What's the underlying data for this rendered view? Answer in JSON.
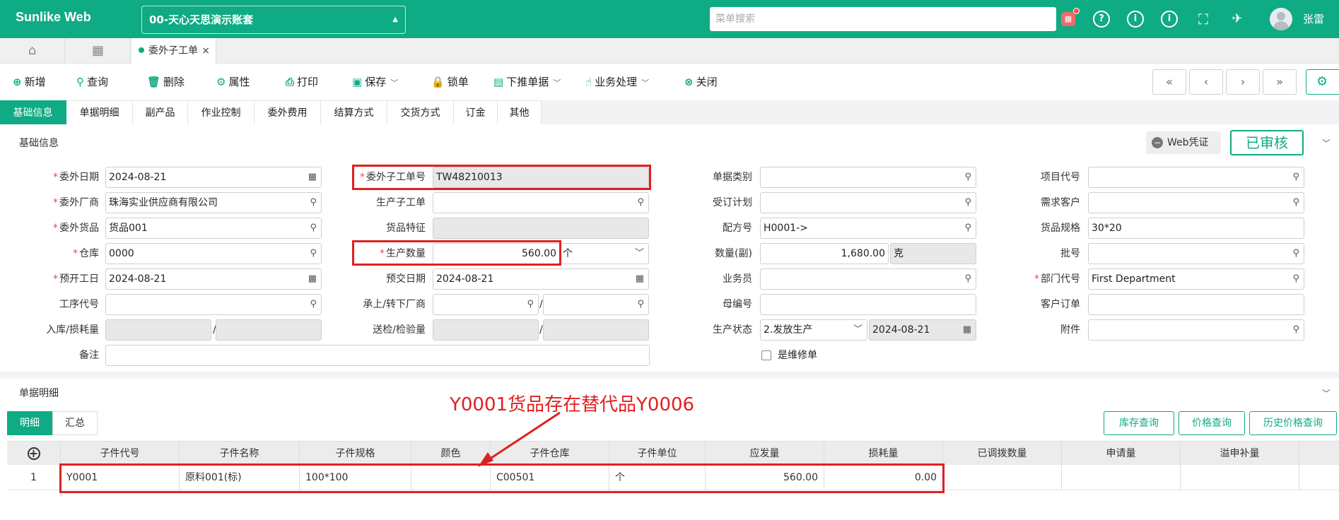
{
  "brand": "Sunlike Web",
  "account": "00-天心天思演示账套",
  "menu_search_placeholder": "菜单搜索",
  "username": "张雷",
  "tabs": {
    "doc_tab": "委外子工单"
  },
  "toolbar": {
    "add": "新增",
    "query": "查询",
    "delete": "删除",
    "props": "属性",
    "print": "打印",
    "save": "保存",
    "lock": "锁单",
    "push": "下推单据",
    "business": "业务处理",
    "close": "关闭"
  },
  "subtabs": [
    "基础信息",
    "单据明细",
    "副产品",
    "作业控制",
    "委外费用",
    "结算方式",
    "交货方式",
    "订金",
    "其他"
  ],
  "basic": {
    "title": "基础信息",
    "web_cert": "Web凭证",
    "status": "已审核",
    "fields": {
      "outsource_date": {
        "label": "委外日期",
        "value": "2024-08-21"
      },
      "vendor": {
        "label": "委外厂商",
        "value": "珠海实业供应商有限公司"
      },
      "outsource_goods": {
        "label": "委外货品",
        "value": "货品001"
      },
      "warehouse": {
        "label": "仓库",
        "value": "0000"
      },
      "plan_start": {
        "label": "预开工日",
        "value": "2024-08-21"
      },
      "process_code": {
        "label": "工序代号",
        "value": ""
      },
      "in_loss_qty": {
        "label": "入库/损耗量",
        "value": ""
      },
      "remark": {
        "label": "备注",
        "value": ""
      },
      "order_no": {
        "label": "委外子工单号",
        "value": "TW48210013"
      },
      "prod_sub_order": {
        "label": "生产子工单",
        "value": ""
      },
      "goods_feature": {
        "label": "货品特征",
        "value": ""
      },
      "prod_qty": {
        "label": "生产数量",
        "value": "560.00",
        "unit": "个"
      },
      "plan_delivery": {
        "label": "预交日期",
        "value": "2024-08-21"
      },
      "up_down_vendor": {
        "label": "承上/转下厂商",
        "value": ""
      },
      "inspect_qty": {
        "label": "送检/检验量",
        "value": ""
      },
      "doc_category": {
        "label": "单据类别",
        "value": ""
      },
      "order_plan": {
        "label": "受订计划",
        "value": ""
      },
      "formula_no": {
        "label": "配方号",
        "value": "H0001->"
      },
      "qty_sub": {
        "label": "数量(副)",
        "value": "1,680.00",
        "unit": "克"
      },
      "salesperson": {
        "label": "业务员",
        "value": ""
      },
      "parent_no": {
        "label": "母编号",
        "value": ""
      },
      "prod_status": {
        "label": "生产状态",
        "value": "2.发放生产",
        "date": "2024-08-21"
      },
      "is_repair": {
        "label": "是维修单"
      },
      "project_code": {
        "label": "项目代号",
        "value": ""
      },
      "demand_customer": {
        "label": "需求客户",
        "value": ""
      },
      "goods_spec": {
        "label": "货品规格",
        "value": "30*20"
      },
      "batch_no": {
        "label": "批号",
        "value": ""
      },
      "dept_code": {
        "label": "部门代号",
        "value": "First Department"
      },
      "customer_order": {
        "label": "客户订单",
        "value": ""
      },
      "attachment": {
        "label": "附件",
        "value": ""
      }
    }
  },
  "detail": {
    "title": "单据明细",
    "tabs": [
      "明细",
      "汇总"
    ],
    "buttons": [
      "库存查询",
      "价格查询",
      "历史价格查询"
    ],
    "columns": [
      "子件代号",
      "子件名称",
      "子件规格",
      "颜色",
      "子件仓库",
      "子件单位",
      "应发量",
      "损耗量",
      "已调拨数量",
      "申请量",
      "溢申补量"
    ],
    "rows": [
      {
        "idx": "1",
        "code": "Y0001",
        "name": "原料001(标)",
        "spec": "100*100",
        "color": "",
        "warehouse": "C00501",
        "unit": "个",
        "issue_qty": "560.00",
        "loss_qty": "0.00",
        "transferred": "",
        "applied": "",
        "extra": ""
      }
    ]
  },
  "annotation": "Y0001货品存在替代品Y0006",
  "colors": {
    "brand": "#0fab84",
    "highlight": "#e02020"
  }
}
